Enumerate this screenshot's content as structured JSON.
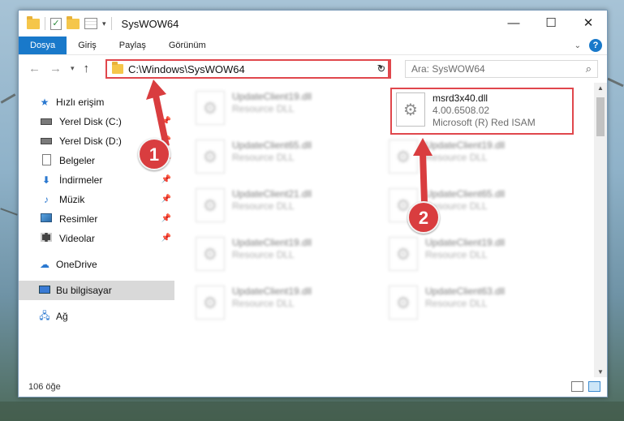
{
  "window": {
    "title": "SysWOW64",
    "controls": {
      "minimize": "—",
      "maximize": "☐",
      "close": "✕"
    }
  },
  "ribbon": {
    "tabs": [
      "Dosya",
      "Giriş",
      "Paylaş",
      "Görünüm"
    ],
    "active_tab": "Dosya",
    "help": "?"
  },
  "address_bar": {
    "path": "C:\\Windows\\SysWOW64",
    "search_placeholder": "Ara: SysWOW64"
  },
  "sidebar": {
    "quick_access": "Hızlı erişim",
    "items": [
      {
        "label": "Yerel Disk (C:)",
        "icon": "drive-icon"
      },
      {
        "label": "Yerel Disk (D:)",
        "icon": "drive-icon"
      },
      {
        "label": "Belgeler",
        "icon": "documents-icon"
      },
      {
        "label": "İndirmeler",
        "icon": "downloads-icon"
      },
      {
        "label": "Müzik",
        "icon": "music-icon"
      },
      {
        "label": "Resimler",
        "icon": "pictures-icon"
      },
      {
        "label": "Videolar",
        "icon": "videos-icon"
      }
    ],
    "onedrive": "OneDrive",
    "this_pc": "Bu bilgisayar",
    "network": "Ağ"
  },
  "files": {
    "left_column": [
      {
        "name": "UpdateClient19.dll",
        "type": "Resource DLL"
      },
      {
        "name": "UpdateClient65.dll",
        "type": "Resource DLL"
      },
      {
        "name": "UpdateClient21.dll",
        "type": "Resource DLL"
      },
      {
        "name": "UpdateClient19.dll",
        "type": "Resource DLL"
      },
      {
        "name": "UpdateClient19.dll",
        "type": "Resource DLL"
      }
    ],
    "right_column": [
      {
        "name": "UpdateClient19.dll",
        "type": "Resource DLL"
      },
      {
        "name": "UpdateClient65.dll",
        "type": "Resource DLL"
      },
      {
        "name": "UpdateClient19.dll",
        "type": "Resource DLL"
      },
      {
        "name": "UpdateClient63.dll",
        "type": "Resource DLL"
      }
    ],
    "highlighted": {
      "name": "msrd3x40.dll",
      "version": "4.00.6508.02",
      "description": "Microsoft (R) Red ISAM"
    }
  },
  "status": {
    "item_count": "106 öğe"
  },
  "annotations": {
    "step1": "1",
    "step2": "2",
    "color": "#d93d3f"
  }
}
